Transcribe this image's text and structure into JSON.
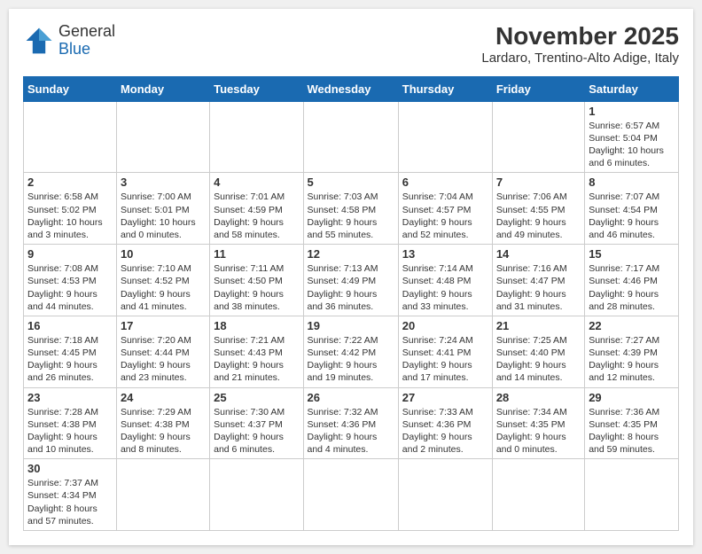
{
  "header": {
    "logo_general": "General",
    "logo_blue": "Blue",
    "title": "November 2025",
    "subtitle": "Lardaro, Trentino-Alto Adige, Italy"
  },
  "weekdays": [
    "Sunday",
    "Monday",
    "Tuesday",
    "Wednesday",
    "Thursday",
    "Friday",
    "Saturday"
  ],
  "days": [
    {
      "date": "",
      "info": ""
    },
    {
      "date": "",
      "info": ""
    },
    {
      "date": "",
      "info": ""
    },
    {
      "date": "",
      "info": ""
    },
    {
      "date": "",
      "info": ""
    },
    {
      "date": "",
      "info": ""
    },
    {
      "date": "1",
      "info": "Sunrise: 6:57 AM\nSunset: 5:04 PM\nDaylight: 10 hours and 6 minutes."
    },
    {
      "date": "2",
      "info": "Sunrise: 6:58 AM\nSunset: 5:02 PM\nDaylight: 10 hours and 3 minutes."
    },
    {
      "date": "3",
      "info": "Sunrise: 7:00 AM\nSunset: 5:01 PM\nDaylight: 10 hours and 0 minutes."
    },
    {
      "date": "4",
      "info": "Sunrise: 7:01 AM\nSunset: 4:59 PM\nDaylight: 9 hours and 58 minutes."
    },
    {
      "date": "5",
      "info": "Sunrise: 7:03 AM\nSunset: 4:58 PM\nDaylight: 9 hours and 55 minutes."
    },
    {
      "date": "6",
      "info": "Sunrise: 7:04 AM\nSunset: 4:57 PM\nDaylight: 9 hours and 52 minutes."
    },
    {
      "date": "7",
      "info": "Sunrise: 7:06 AM\nSunset: 4:55 PM\nDaylight: 9 hours and 49 minutes."
    },
    {
      "date": "8",
      "info": "Sunrise: 7:07 AM\nSunset: 4:54 PM\nDaylight: 9 hours and 46 minutes."
    },
    {
      "date": "9",
      "info": "Sunrise: 7:08 AM\nSunset: 4:53 PM\nDaylight: 9 hours and 44 minutes."
    },
    {
      "date": "10",
      "info": "Sunrise: 7:10 AM\nSunset: 4:52 PM\nDaylight: 9 hours and 41 minutes."
    },
    {
      "date": "11",
      "info": "Sunrise: 7:11 AM\nSunset: 4:50 PM\nDaylight: 9 hours and 38 minutes."
    },
    {
      "date": "12",
      "info": "Sunrise: 7:13 AM\nSunset: 4:49 PM\nDaylight: 9 hours and 36 minutes."
    },
    {
      "date": "13",
      "info": "Sunrise: 7:14 AM\nSunset: 4:48 PM\nDaylight: 9 hours and 33 minutes."
    },
    {
      "date": "14",
      "info": "Sunrise: 7:16 AM\nSunset: 4:47 PM\nDaylight: 9 hours and 31 minutes."
    },
    {
      "date": "15",
      "info": "Sunrise: 7:17 AM\nSunset: 4:46 PM\nDaylight: 9 hours and 28 minutes."
    },
    {
      "date": "16",
      "info": "Sunrise: 7:18 AM\nSunset: 4:45 PM\nDaylight: 9 hours and 26 minutes."
    },
    {
      "date": "17",
      "info": "Sunrise: 7:20 AM\nSunset: 4:44 PM\nDaylight: 9 hours and 23 minutes."
    },
    {
      "date": "18",
      "info": "Sunrise: 7:21 AM\nSunset: 4:43 PM\nDaylight: 9 hours and 21 minutes."
    },
    {
      "date": "19",
      "info": "Sunrise: 7:22 AM\nSunset: 4:42 PM\nDaylight: 9 hours and 19 minutes."
    },
    {
      "date": "20",
      "info": "Sunrise: 7:24 AM\nSunset: 4:41 PM\nDaylight: 9 hours and 17 minutes."
    },
    {
      "date": "21",
      "info": "Sunrise: 7:25 AM\nSunset: 4:40 PM\nDaylight: 9 hours and 14 minutes."
    },
    {
      "date": "22",
      "info": "Sunrise: 7:27 AM\nSunset: 4:39 PM\nDaylight: 9 hours and 12 minutes."
    },
    {
      "date": "23",
      "info": "Sunrise: 7:28 AM\nSunset: 4:38 PM\nDaylight: 9 hours and 10 minutes."
    },
    {
      "date": "24",
      "info": "Sunrise: 7:29 AM\nSunset: 4:38 PM\nDaylight: 9 hours and 8 minutes."
    },
    {
      "date": "25",
      "info": "Sunrise: 7:30 AM\nSunset: 4:37 PM\nDaylight: 9 hours and 6 minutes."
    },
    {
      "date": "26",
      "info": "Sunrise: 7:32 AM\nSunset: 4:36 PM\nDaylight: 9 hours and 4 minutes."
    },
    {
      "date": "27",
      "info": "Sunrise: 7:33 AM\nSunset: 4:36 PM\nDaylight: 9 hours and 2 minutes."
    },
    {
      "date": "28",
      "info": "Sunrise: 7:34 AM\nSunset: 4:35 PM\nDaylight: 9 hours and 0 minutes."
    },
    {
      "date": "29",
      "info": "Sunrise: 7:36 AM\nSunset: 4:35 PM\nDaylight: 8 hours and 59 minutes."
    },
    {
      "date": "30",
      "info": "Sunrise: 7:37 AM\nSunset: 4:34 PM\nDaylight: 8 hours and 57 minutes."
    },
    {
      "date": "",
      "info": ""
    },
    {
      "date": "",
      "info": ""
    },
    {
      "date": "",
      "info": ""
    },
    {
      "date": "",
      "info": ""
    },
    {
      "date": "",
      "info": ""
    },
    {
      "date": "",
      "info": ""
    }
  ]
}
